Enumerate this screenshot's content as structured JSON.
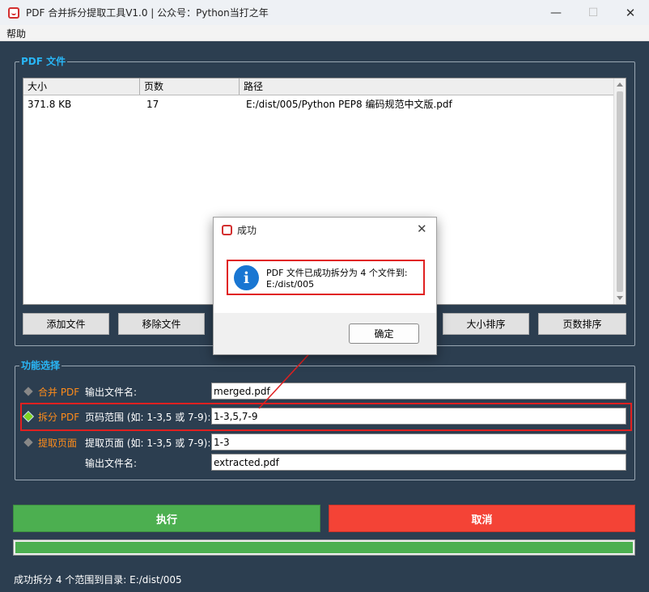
{
  "window": {
    "title": "PDF 合并拆分提取工具V1.0 | 公众号：Python当打之年"
  },
  "menu": {
    "help": "帮助"
  },
  "pdf_group": {
    "title": "PDF 文件",
    "columns": [
      "大小",
      "页数",
      "路径"
    ],
    "rows": [
      {
        "size": "371.8 KB",
        "pages": "17",
        "path": "E:/dist/005/Python PEP8 编码规范中文版.pdf"
      }
    ],
    "buttons": {
      "add": "添加文件",
      "remove": "移除文件",
      "sort_size": "大小排序",
      "sort_pages": "页数排序"
    }
  },
  "func_group": {
    "title": "功能选择",
    "merge": {
      "label": "合并 PDF",
      "field_label": "输出文件名:",
      "value": "merged.pdf",
      "selected": false
    },
    "split": {
      "label": "拆分 PDF",
      "field_label": "页码范围 (如: 1-3,5 或 7-9):",
      "value": "1-3,5,7-9",
      "selected": true
    },
    "extract": {
      "label": "提取页面",
      "field_label": "提取页面 (如: 1-3,5 或 7-9):",
      "value": "1-3",
      "output_label": "输出文件名:",
      "output_value": "extracted.pdf",
      "selected": false
    }
  },
  "actions": {
    "run": "执行",
    "cancel": "取消"
  },
  "progress": {
    "percent": 100
  },
  "status": "成功拆分 4 个范围到目录: E:/dist/005",
  "dialog": {
    "title": "成功",
    "message_line1": "PDF 文件已成功拆分为 4 个文件到:",
    "message_line2": "E:/dist/005",
    "ok": "确定"
  },
  "colors": {
    "run": "#4caf50",
    "cancel": "#f44336",
    "group_title": "#29b6f6",
    "option": "#ff8c1a",
    "highlight": "#e02020",
    "background": "#2c3e50"
  }
}
